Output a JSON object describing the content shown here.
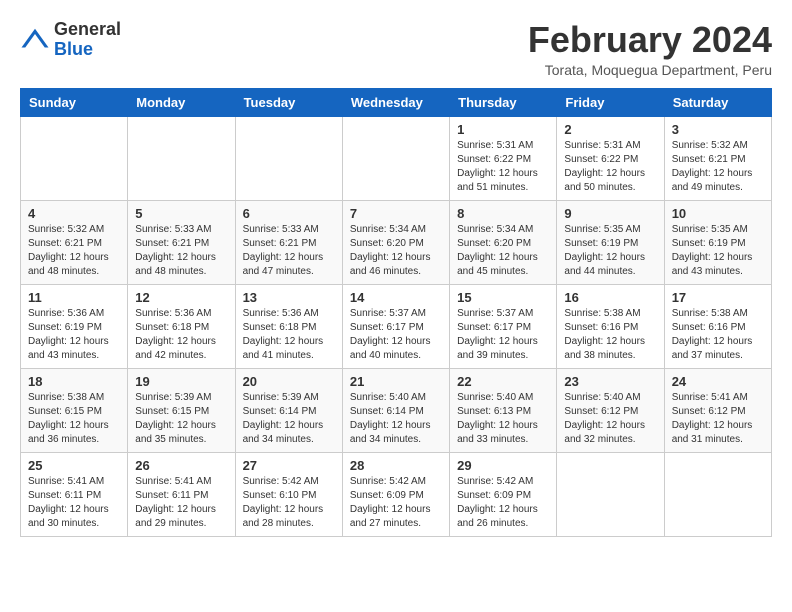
{
  "logo": {
    "general": "General",
    "blue": "Blue"
  },
  "title": "February 2024",
  "location": "Torata, Moquegua Department, Peru",
  "days_of_week": [
    "Sunday",
    "Monday",
    "Tuesday",
    "Wednesday",
    "Thursday",
    "Friday",
    "Saturday"
  ],
  "weeks": [
    [
      {
        "day": "",
        "info": ""
      },
      {
        "day": "",
        "info": ""
      },
      {
        "day": "",
        "info": ""
      },
      {
        "day": "",
        "info": ""
      },
      {
        "day": "1",
        "info": "Sunrise: 5:31 AM\nSunset: 6:22 PM\nDaylight: 12 hours\nand 51 minutes."
      },
      {
        "day": "2",
        "info": "Sunrise: 5:31 AM\nSunset: 6:22 PM\nDaylight: 12 hours\nand 50 minutes."
      },
      {
        "day": "3",
        "info": "Sunrise: 5:32 AM\nSunset: 6:21 PM\nDaylight: 12 hours\nand 49 minutes."
      }
    ],
    [
      {
        "day": "4",
        "info": "Sunrise: 5:32 AM\nSunset: 6:21 PM\nDaylight: 12 hours\nand 48 minutes."
      },
      {
        "day": "5",
        "info": "Sunrise: 5:33 AM\nSunset: 6:21 PM\nDaylight: 12 hours\nand 48 minutes."
      },
      {
        "day": "6",
        "info": "Sunrise: 5:33 AM\nSunset: 6:21 PM\nDaylight: 12 hours\nand 47 minutes."
      },
      {
        "day": "7",
        "info": "Sunrise: 5:34 AM\nSunset: 6:20 PM\nDaylight: 12 hours\nand 46 minutes."
      },
      {
        "day": "8",
        "info": "Sunrise: 5:34 AM\nSunset: 6:20 PM\nDaylight: 12 hours\nand 45 minutes."
      },
      {
        "day": "9",
        "info": "Sunrise: 5:35 AM\nSunset: 6:19 PM\nDaylight: 12 hours\nand 44 minutes."
      },
      {
        "day": "10",
        "info": "Sunrise: 5:35 AM\nSunset: 6:19 PM\nDaylight: 12 hours\nand 43 minutes."
      }
    ],
    [
      {
        "day": "11",
        "info": "Sunrise: 5:36 AM\nSunset: 6:19 PM\nDaylight: 12 hours\nand 43 minutes."
      },
      {
        "day": "12",
        "info": "Sunrise: 5:36 AM\nSunset: 6:18 PM\nDaylight: 12 hours\nand 42 minutes."
      },
      {
        "day": "13",
        "info": "Sunrise: 5:36 AM\nSunset: 6:18 PM\nDaylight: 12 hours\nand 41 minutes."
      },
      {
        "day": "14",
        "info": "Sunrise: 5:37 AM\nSunset: 6:17 PM\nDaylight: 12 hours\nand 40 minutes."
      },
      {
        "day": "15",
        "info": "Sunrise: 5:37 AM\nSunset: 6:17 PM\nDaylight: 12 hours\nand 39 minutes."
      },
      {
        "day": "16",
        "info": "Sunrise: 5:38 AM\nSunset: 6:16 PM\nDaylight: 12 hours\nand 38 minutes."
      },
      {
        "day": "17",
        "info": "Sunrise: 5:38 AM\nSunset: 6:16 PM\nDaylight: 12 hours\nand 37 minutes."
      }
    ],
    [
      {
        "day": "18",
        "info": "Sunrise: 5:38 AM\nSunset: 6:15 PM\nDaylight: 12 hours\nand 36 minutes."
      },
      {
        "day": "19",
        "info": "Sunrise: 5:39 AM\nSunset: 6:15 PM\nDaylight: 12 hours\nand 35 minutes."
      },
      {
        "day": "20",
        "info": "Sunrise: 5:39 AM\nSunset: 6:14 PM\nDaylight: 12 hours\nand 34 minutes."
      },
      {
        "day": "21",
        "info": "Sunrise: 5:40 AM\nSunset: 6:14 PM\nDaylight: 12 hours\nand 34 minutes."
      },
      {
        "day": "22",
        "info": "Sunrise: 5:40 AM\nSunset: 6:13 PM\nDaylight: 12 hours\nand 33 minutes."
      },
      {
        "day": "23",
        "info": "Sunrise: 5:40 AM\nSunset: 6:12 PM\nDaylight: 12 hours\nand 32 minutes."
      },
      {
        "day": "24",
        "info": "Sunrise: 5:41 AM\nSunset: 6:12 PM\nDaylight: 12 hours\nand 31 minutes."
      }
    ],
    [
      {
        "day": "25",
        "info": "Sunrise: 5:41 AM\nSunset: 6:11 PM\nDaylight: 12 hours\nand 30 minutes."
      },
      {
        "day": "26",
        "info": "Sunrise: 5:41 AM\nSunset: 6:11 PM\nDaylight: 12 hours\nand 29 minutes."
      },
      {
        "day": "27",
        "info": "Sunrise: 5:42 AM\nSunset: 6:10 PM\nDaylight: 12 hours\nand 28 minutes."
      },
      {
        "day": "28",
        "info": "Sunrise: 5:42 AM\nSunset: 6:09 PM\nDaylight: 12 hours\nand 27 minutes."
      },
      {
        "day": "29",
        "info": "Sunrise: 5:42 AM\nSunset: 6:09 PM\nDaylight: 12 hours\nand 26 minutes."
      },
      {
        "day": "",
        "info": ""
      },
      {
        "day": "",
        "info": ""
      }
    ]
  ]
}
